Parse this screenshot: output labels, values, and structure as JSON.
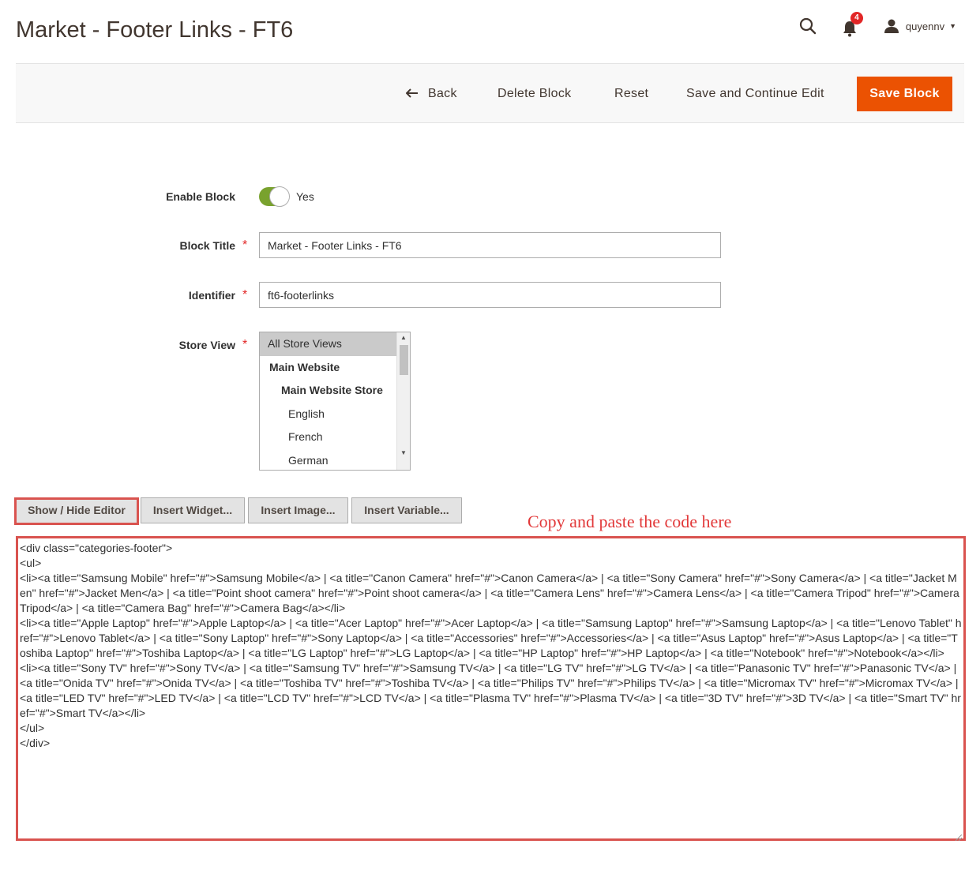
{
  "page": {
    "title": "Market - Footer Links - FT6"
  },
  "header": {
    "notifications_count": "4",
    "user_name": "quyennv",
    "icons": [
      "search-icon",
      "bell-icon",
      "user-icon",
      "caret-down-icon"
    ]
  },
  "actions": {
    "back": "Back",
    "delete": "Delete Block",
    "reset": "Reset",
    "save_continue": "Save and Continue Edit",
    "save": "Save Block",
    "primary_color": "#eb5202"
  },
  "form": {
    "enable_block": {
      "label": "Enable Block",
      "value": "Yes",
      "enabled": true
    },
    "block_title": {
      "label": "Block Title",
      "value": "Market - Footer Links - FT6"
    },
    "identifier": {
      "label": "Identifier",
      "value": "ft6-footerlinks"
    },
    "store_view": {
      "label": "Store View",
      "options": [
        "All Store Views",
        "Main Website",
        "Main Website Store",
        "English",
        "French",
        "German"
      ],
      "selected": "All Store Views"
    },
    "required_mark": "*"
  },
  "editor": {
    "buttons": {
      "show_hide": "Show / Hide Editor",
      "insert_widget": "Insert Widget...",
      "insert_image": "Insert Image...",
      "insert_variable": "Insert Variable..."
    },
    "annotation": "Copy and paste the code here",
    "content": "<div class=\"categories-footer\">\n<ul>\n<li><a title=\"Samsung Mobile\" href=\"#\">Samsung Mobile</a> | <a title=\"Canon Camera\" href=\"#\">Canon Camera</a> | <a title=\"Sony Camera\" href=\"#\">Sony Camera</a> | <a title=\"Jacket Men\" href=\"#\">Jacket Men</a> | <a title=\"Point shoot camera\" href=\"#\">Point shoot camera</a> | <a title=\"Camera Lens\" href=\"#\">Camera Lens</a> | <a title=\"Camera Tripod\" href=\"#\">Camera Tripod</a> | <a title=\"Camera Bag\" href=\"#\">Camera Bag</a></li>\n<li><a title=\"Apple Laptop\" href=\"#\">Apple Laptop</a> | <a title=\"Acer Laptop\" href=\"#\">Acer Laptop</a> | <a title=\"Samsung Laptop\" href=\"#\">Samsung Laptop</a> | <a title=\"Lenovo Tablet\" href=\"#\">Lenovo Tablet</a> | <a title=\"Sony Laptop\" href=\"#\">Sony Laptop</a> | <a title=\"Accessories\" href=\"#\">Accessories</a> | <a title=\"Asus Laptop\" href=\"#\">Asus Laptop</a> | <a title=\"Toshiba Laptop\" href=\"#\">Toshiba Laptop</a> | <a title=\"LG Laptop\" href=\"#\">LG Laptop</a> | <a title=\"HP Laptop\" href=\"#\">HP Laptop</a> | <a title=\"Notebook\" href=\"#\">Notebook</a></li>\n<li><a title=\"Sony TV\" href=\"#\">Sony TV</a> | <a title=\"Samsung TV\" href=\"#\">Samsung TV</a> | <a title=\"LG TV\" href=\"#\">LG TV</a> | <a title=\"Panasonic TV\" href=\"#\">Panasonic TV</a> | <a title=\"Onida TV\" href=\"#\">Onida TV</a> | <a title=\"Toshiba TV\" href=\"#\">Toshiba TV</a> | <a title=\"Philips TV\" href=\"#\">Philips TV</a> | <a title=\"Micromax TV\" href=\"#\">Micromax TV</a> | <a title=\"LED TV\" href=\"#\">LED TV</a> | <a title=\"LCD TV\" href=\"#\">LCD TV</a> | <a title=\"Plasma TV\" href=\"#\">Plasma TV</a> | <a title=\"3D TV\" href=\"#\">3D TV</a> | <a title=\"Smart TV\" href=\"#\">Smart TV</a></li>\n</ul>\n</div>"
  }
}
